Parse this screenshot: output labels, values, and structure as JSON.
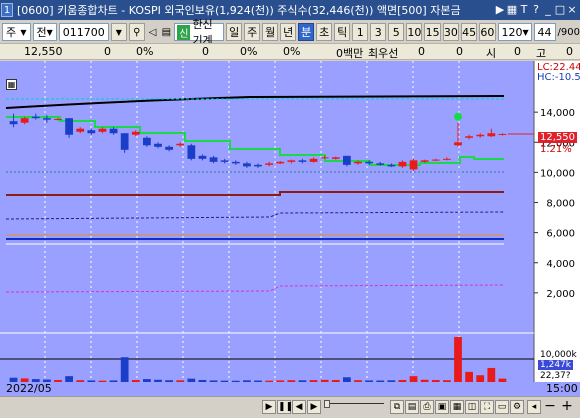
{
  "window": {
    "badge": "1",
    "title": "[0600] 키움종합차트 - KOSPI 외국인보유(1,924(천)) 주식수(32,446(천)) 액면[500] 자본금",
    "buttons": [
      "▶",
      "▦",
      "T",
      "?",
      "_",
      "□",
      "×"
    ]
  },
  "toolbar": {
    "market": "주",
    "market_type": "전",
    "code": "011700",
    "stock_name": "한신기계",
    "stock_mark": "신",
    "periods": [
      "일",
      "주",
      "월",
      "년",
      "분",
      "초",
      "틱"
    ],
    "active_period": "분",
    "intervals": [
      "1",
      "3",
      "5",
      "10",
      "15",
      "30",
      "45",
      "60"
    ],
    "count": "120",
    "page": "44",
    "page_total": "/900"
  },
  "infostrip": {
    "price": "12,550",
    "change": "0",
    "change_pct": "0%",
    "volume": "0",
    "volume_pct": "0%",
    "turnover_pct": "0%",
    "amount": "0백만",
    "best_ask": "최우선",
    "v1": "0",
    "v2": "0",
    "label_si": "시",
    "v3": "0",
    "label_go": "고",
    "v4": "0"
  },
  "chart_data": {
    "type": "candlestick",
    "axis": {
      "y_ticks": [
        2000,
        4000,
        6000,
        8000,
        10000,
        12000,
        14000
      ],
      "y_tick_labels": [
        "2,000",
        "4,000",
        "6,000",
        "8,000",
        "10,000",
        "12,000",
        "14,000"
      ],
      "ylim": [
        0,
        16600
      ]
    },
    "labels": {
      "lc": "LC:22.44",
      "hc": "HC:-10.5",
      "current_price": "12,550",
      "current_pct": "1.21%",
      "vol_tick": "10,000k",
      "vol_current": "1,247k",
      "vol_ref": "22,37?"
    },
    "candles": [
      {
        "o": 13400,
        "c": 13200,
        "h": 13900,
        "l": 13000
      },
      {
        "o": 13300,
        "c": 13600,
        "h": 13700,
        "l": 13200
      },
      {
        "o": 13700,
        "c": 13600,
        "h": 13900,
        "l": 13500
      },
      {
        "o": 13600,
        "c": 13500,
        "h": 13800,
        "l": 13300
      },
      {
        "o": 13500,
        "c": 13550,
        "h": 13600,
        "l": 13450
      },
      {
        "o": 13600,
        "c": 12500,
        "h": 13600,
        "l": 12300
      },
      {
        "o": 12700,
        "c": 12900,
        "h": 13000,
        "l": 12600
      },
      {
        "o": 12800,
        "c": 12600,
        "h": 12900,
        "l": 12500
      },
      {
        "o": 12700,
        "c": 12900,
        "h": 13000,
        "l": 12600
      },
      {
        "o": 12900,
        "c": 12600,
        "h": 13000,
        "l": 12500
      },
      {
        "o": 12600,
        "c": 11500,
        "h": 12600,
        "l": 11300
      },
      {
        "o": 12500,
        "c": 12700,
        "h": 12800,
        "l": 12400
      },
      {
        "o": 12300,
        "c": 11800,
        "h": 12400,
        "l": 11700
      },
      {
        "o": 11900,
        "c": 11700,
        "h": 12000,
        "l": 11600
      },
      {
        "o": 11700,
        "c": 11500,
        "h": 11800,
        "l": 11400
      },
      {
        "o": 11800,
        "c": 11900,
        "h": 12000,
        "l": 11700
      },
      {
        "o": 11800,
        "c": 10900,
        "h": 11900,
        "l": 10800
      },
      {
        "o": 11100,
        "c": 10900,
        "h": 11200,
        "l": 10800
      },
      {
        "o": 11000,
        "c": 10700,
        "h": 11100,
        "l": 10600
      },
      {
        "o": 10800,
        "c": 10700,
        "h": 10900,
        "l": 10600
      },
      {
        "o": 10700,
        "c": 10600,
        "h": 10800,
        "l": 10500
      },
      {
        "o": 10600,
        "c": 10400,
        "h": 10700,
        "l": 10300
      },
      {
        "o": 10500,
        "c": 10400,
        "h": 10600,
        "l": 10300
      },
      {
        "o": 10500,
        "c": 10600,
        "h": 10700,
        "l": 10400
      },
      {
        "o": 10600,
        "c": 10700,
        "h": 10750,
        "l": 10550
      },
      {
        "o": 10700,
        "c": 10800,
        "h": 10850,
        "l": 10600
      },
      {
        "o": 10800,
        "c": 10700,
        "h": 10900,
        "l": 10600
      },
      {
        "o": 10700,
        "c": 10900,
        "h": 11000,
        "l": 10650
      },
      {
        "o": 10950,
        "c": 11000,
        "h": 11100,
        "l": 10900
      },
      {
        "o": 10900,
        "c": 11000,
        "h": 11050,
        "l": 10850
      },
      {
        "o": 11100,
        "c": 10500,
        "h": 11100,
        "l": 10400
      },
      {
        "o": 10600,
        "c": 10700,
        "h": 10800,
        "l": 10500
      },
      {
        "o": 10700,
        "c": 10600,
        "h": 10800,
        "l": 10500
      },
      {
        "o": 10600,
        "c": 10500,
        "h": 10700,
        "l": 10450
      },
      {
        "o": 10500,
        "c": 10400,
        "h": 10600,
        "l": 10350
      },
      {
        "o": 10400,
        "c": 10700,
        "h": 10800,
        "l": 10300
      },
      {
        "o": 10200,
        "c": 10800,
        "h": 10900,
        "l": 10100
      },
      {
        "o": 10700,
        "c": 10800,
        "h": 10850,
        "l": 10650
      },
      {
        "o": 10800,
        "c": 10850,
        "h": 10900,
        "l": 10750
      },
      {
        "o": 10850,
        "c": 10900,
        "h": 11000,
        "l": 10800
      },
      {
        "o": 11800,
        "c": 12000,
        "h": 13300,
        "l": 11700
      },
      {
        "o": 12300,
        "c": 12400,
        "h": 12500,
        "l": 12200
      },
      {
        "o": 12400,
        "c": 12500,
        "h": 12600,
        "l": 12300
      },
      {
        "o": 12400,
        "c": 12600,
        "h": 12900,
        "l": 12350
      },
      {
        "o": 12500,
        "c": 12550,
        "h": 12600,
        "l": 12450
      }
    ],
    "volumes": [
      380,
      320,
      260,
      220,
      180,
      520,
      160,
      140,
      120,
      140,
      2200,
      180,
      260,
      200,
      160,
      150,
      300,
      180,
      140,
      120,
      110,
      150,
      130,
      120,
      140,
      160,
      150,
      170,
      190,
      180,
      420,
      160,
      140,
      130,
      150,
      180,
      520,
      200,
      180,
      160,
      4000,
      900,
      600,
      1247,
      300
    ],
    "date_start": "2022/05",
    "date_end": "15:00"
  },
  "bottombar": {
    "buttons": [
      "▶",
      "❚❚",
      "◀",
      "▶",
      "▸▸"
    ],
    "zoom_minus": "−",
    "zoom_plus": "+"
  }
}
